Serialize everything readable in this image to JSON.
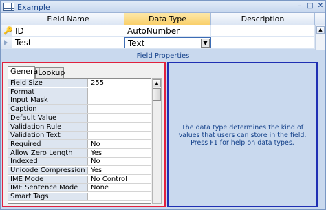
{
  "window": {
    "title": "Example",
    "controls": {
      "minimize": "–",
      "maximize": "□",
      "close": "✕"
    }
  },
  "grid": {
    "columns": [
      "Field Name",
      "Data Type",
      "Description"
    ],
    "rows": [
      {
        "field_name": "ID",
        "data_type": "AutoNumber",
        "description": "",
        "primary_key": true
      },
      {
        "field_name": "Test",
        "data_type": "Text",
        "description": "",
        "selected": true
      }
    ]
  },
  "field_properties_label": "Field Properties",
  "tabs": [
    "General",
    "Lookup"
  ],
  "active_tab": "General",
  "properties": [
    {
      "label": "Field Size",
      "value": "255"
    },
    {
      "label": "Format",
      "value": ""
    },
    {
      "label": "Input Mask",
      "value": ""
    },
    {
      "label": "Caption",
      "value": ""
    },
    {
      "label": "Default Value",
      "value": ""
    },
    {
      "label": "Validation Rule",
      "value": ""
    },
    {
      "label": "Validation Text",
      "value": ""
    },
    {
      "label": "Required",
      "value": "No"
    },
    {
      "label": "Allow Zero Length",
      "value": "Yes"
    },
    {
      "label": "Indexed",
      "value": "No"
    },
    {
      "label": "Unicode Compression",
      "value": "Yes"
    },
    {
      "label": "IME Mode",
      "value": "No Control"
    },
    {
      "label": "IME Sentence Mode",
      "value": "None"
    },
    {
      "label": "Smart Tags",
      "value": ""
    }
  ],
  "help_text": "The data type determines the kind of values that users can store in the field.  Press F1 for help on data types.",
  "colors": {
    "left_pane_border": "#e0213e",
    "right_pane_border": "#1f2fb3",
    "selected_column_header": "#f9cf6a"
  }
}
